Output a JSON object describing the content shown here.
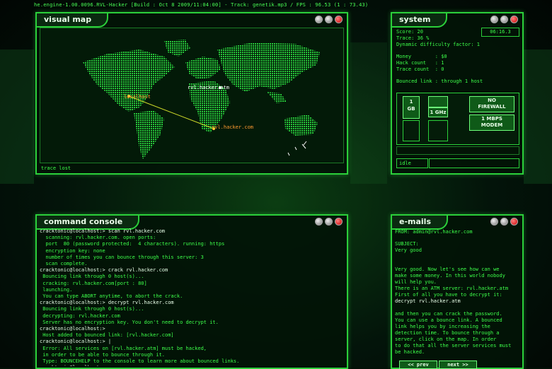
{
  "topbar": {
    "text": "he.engine-1.00.0096.RVL-Hacker [Build : Oct  8 2009/11:04:00] - Track: genetik.mp3 / FPS : 96.53 (1 : 73.43)"
  },
  "visual_map": {
    "title": "visual map",
    "status": "trace lost",
    "labels": {
      "localhost": "localhost",
      "atm": "rvl.hacker.atm",
      "com": "rvl.hacker.com"
    }
  },
  "system": {
    "title": "system",
    "clock": "06:16.3",
    "lines": [
      "Score: 20",
      "Trace: 36 %",
      "Dynamic difficulty factor: 1",
      "",
      "Money        : $0",
      "Hack count   : 1",
      "Trace count  : 0",
      "",
      "Bounced link : through 1 host"
    ],
    "hw": {
      "ram": "1\nGB",
      "cpu": "1 GHz",
      "firewall": "NO\nFIREWALL",
      "modem": "1 MBPS\nMODEM"
    },
    "status": "idle"
  },
  "console": {
    "title": "command console",
    "lines": [
      {
        "t": "p",
        "s": "cracktonic@localhost:> scan rvl.hacker.com"
      },
      {
        "t": "o",
        "s": "  scanning: rvl.hacker.com. open ports:"
      },
      {
        "t": "o",
        "s": "  port  80 (password protected:  4 characters). running: https"
      },
      {
        "t": "o",
        "s": "  encryption key: none"
      },
      {
        "t": "o",
        "s": "  number of times you can bounce through this server: 3"
      },
      {
        "t": "o",
        "s": "  scan complete."
      },
      {
        "t": "p",
        "s": "cracktonic@localhost:> crack rvl.hacker.com"
      },
      {
        "t": "o",
        "s": " Bouncing link through 0 host(s)..."
      },
      {
        "t": "o",
        "s": " cracking: rvl.hacker.com[port : 80]"
      },
      {
        "t": "o",
        "s": " launching."
      },
      {
        "t": "o",
        "s": " You can type ABORT anytime, to abort the crack."
      },
      {
        "t": "p",
        "s": "cracktonic@localhost:> decrypt rvl.hacker.com"
      },
      {
        "t": "o",
        "s": " Bouncing link through 0 host(s)..."
      },
      {
        "t": "o",
        "s": " decrypting: rvl.hacker.com"
      },
      {
        "t": "o",
        "s": " Server has no encryption key. You don't need to decrypt it."
      },
      {
        "t": "p",
        "s": "cracktonic@localhost:>"
      },
      {
        "t": "o",
        "s": " Host added to bounced link: [rvl.hacker.com]"
      },
      {
        "t": "p",
        "s": "cracktonic@localhost:> |"
      },
      {
        "t": "o",
        "s": " Error: All services on [rvl.hacker.atm] must be hacked,"
      },
      {
        "t": "o",
        "s": " in order to be able to bounce through it."
      },
      {
        "t": "o",
        "s": " Type: BOUNCEHELP to the console to learn more about bounced links."
      },
      {
        "t": "p",
        "s": "cracktonic@localhost:>"
      }
    ]
  },
  "emails": {
    "title": "e-mails",
    "from": "FROM: admin@rvl.hacker.com",
    "subject_label": "SUBJECT:",
    "subject": "Very good",
    "body_lines": [
      "Very good. Now let's see how can we",
      "make some money. In this world nobody",
      "will help you.",
      "There is an ATM server: rvl.hacker.atm",
      "First of all you have to decrypt it:",
      "decrypt rvl.hacker.atm",
      "",
      "and then you can crack the password.",
      "You can use a bounce link. A bounced",
      "link helps you by increasing the",
      "detection time. To bounce through a",
      "server, click on the map. In order",
      "to do that all the server services must",
      "be hacked."
    ],
    "prev": "<< prev",
    "next": "next >>"
  }
}
